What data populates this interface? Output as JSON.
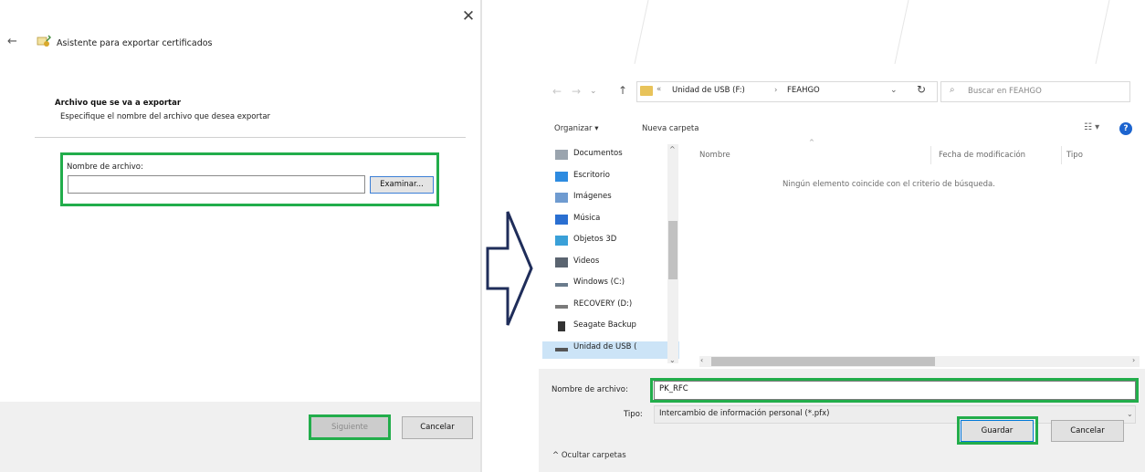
{
  "wizard": {
    "title": "Asistente para exportar certificados",
    "heading": "Archivo que se va a exportar",
    "subheading": "Especifique el nombre del archivo que desea exportar",
    "filename_label": "Nombre de archivo:",
    "filename_value": "",
    "browse_label": "Examinar...",
    "next_label": "Siguiente",
    "cancel_label": "Cancelar",
    "close_glyph": "✕",
    "back_glyph": "←"
  },
  "arrow_icon": "right-arrow-outline",
  "save_dialog": {
    "address": {
      "prefix": "«",
      "drive": "Unidad de USB (F:)",
      "separator": "›",
      "folder": "FEAHGO"
    },
    "search_placeholder": "Buscar en FEAHGO",
    "toolbar": {
      "organize": "Organizar ▾",
      "new_folder": "Nueva carpeta"
    },
    "nav_items": [
      {
        "label": "Documentos",
        "icon": "documents-icon"
      },
      {
        "label": "Escritorio",
        "icon": "desktop-icon"
      },
      {
        "label": "Imágenes",
        "icon": "pictures-icon"
      },
      {
        "label": "Música",
        "icon": "music-icon"
      },
      {
        "label": "Objetos 3D",
        "icon": "objects3d-icon"
      },
      {
        "label": "Videos",
        "icon": "videos-icon"
      },
      {
        "label": "Windows (C:)",
        "icon": "drive-c-icon"
      },
      {
        "label": "RECOVERY (D:)",
        "icon": "drive-icon"
      },
      {
        "label": "Seagate Backup",
        "icon": "external-drive-icon"
      },
      {
        "label": "Unidad de USB (",
        "icon": "usb-drive-icon"
      }
    ],
    "columns": {
      "name": "Nombre",
      "date": "Fecha de modificación",
      "type": "Tipo"
    },
    "empty_message": "Ningún elemento coincide con el criterio de búsqueda.",
    "filename_label": "Nombre de archivo:",
    "filename_value": "PK_RFC",
    "type_label": "Tipo:",
    "type_value": "Intercambio de información personal (*.pfx)",
    "hide_folders": "Ocultar carpetas",
    "save_label": "Guardar",
    "cancel_label": "Cancelar"
  },
  "colors": {
    "highlight": "#22ad4b",
    "arrow_outline": "#1f2d5a",
    "help_blue": "#1c64cf",
    "selection": "#cce4f7"
  }
}
